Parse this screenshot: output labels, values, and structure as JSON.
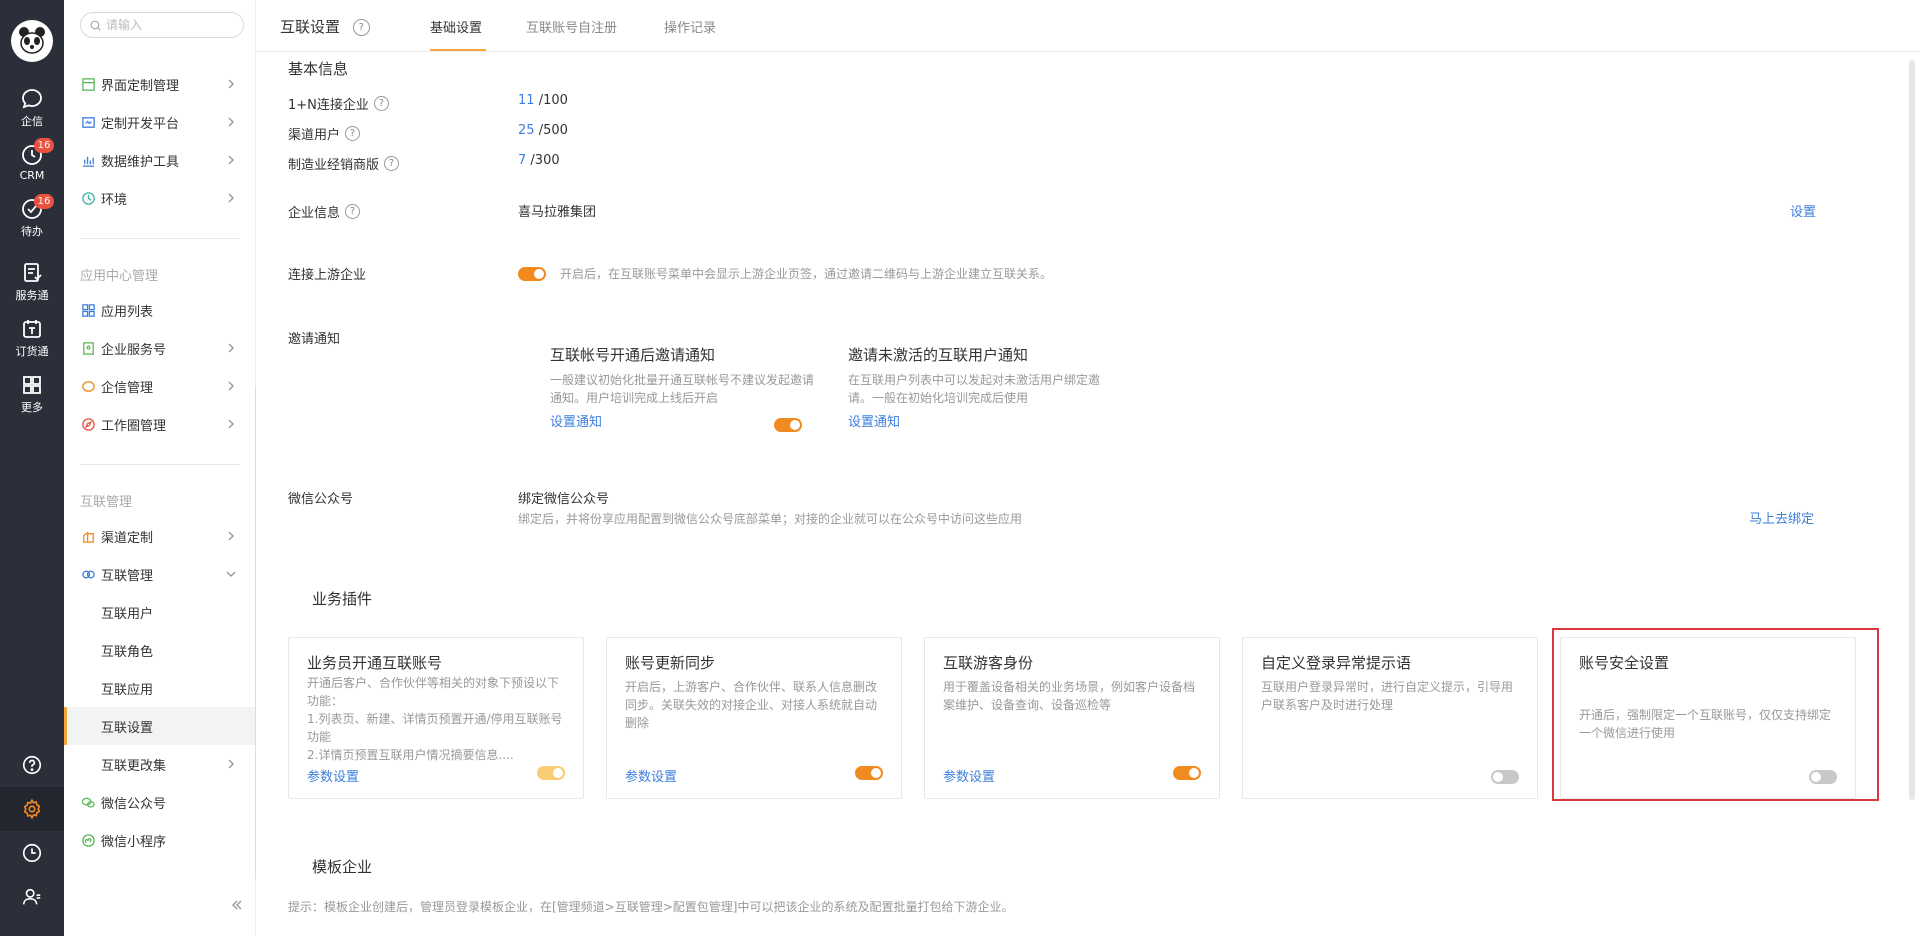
{
  "rail": {
    "items": [
      {
        "label": "企信",
        "icon": "chat-bubble-icon"
      },
      {
        "label": "CRM",
        "icon": "clock-icon",
        "badge": "16"
      },
      {
        "label": "待办",
        "icon": "check-circle-icon",
        "badge": "16"
      },
      {
        "label": "服务通",
        "icon": "service-icon"
      },
      {
        "label": "订货通",
        "icon": "order-icon"
      },
      {
        "label": "更多",
        "icon": "grid-icon"
      }
    ],
    "bottom_icons": [
      "help-circle-icon",
      "gear-icon",
      "history-icon",
      "user-settings-icon"
    ],
    "active_color": "#f28b1f"
  },
  "sidebar": {
    "search_placeholder": "请输入",
    "top_items": [
      {
        "label": "界面定制管理"
      },
      {
        "label": "定制开发平台"
      },
      {
        "label": "数据维护工具"
      },
      {
        "label": "环境"
      }
    ],
    "group_app_center": "应用中心管理",
    "app_items": [
      {
        "label": "应用列表"
      },
      {
        "label": "企业服务号"
      },
      {
        "label": "企信管理"
      },
      {
        "label": "工作圈管理"
      }
    ],
    "group_interconnect": "互联管理",
    "interconnect_items": [
      {
        "label": "渠道定制"
      },
      {
        "label": "互联管理"
      },
      {
        "label": "互联用户"
      },
      {
        "label": "互联角色"
      },
      {
        "label": "互联应用"
      },
      {
        "label": "互联设置"
      },
      {
        "label": "互联更改集"
      },
      {
        "label": "微信公众号"
      },
      {
        "label": "微信小程序"
      }
    ]
  },
  "header": {
    "title": "互联设置",
    "tabs": [
      {
        "label": "基础设置"
      },
      {
        "label": "互联账号自注册"
      },
      {
        "label": "操作记录"
      }
    ]
  },
  "basic": {
    "title": "基本信息",
    "stats": [
      {
        "label": "1+N连接企业",
        "used": "11",
        "total": "/100"
      },
      {
        "label": "渠道用户",
        "used": "25",
        "total": "/500"
      },
      {
        "label": "制造业经销商版",
        "used": "7",
        "total": "/300"
      }
    ],
    "enterprise_label": "企业信息",
    "enterprise_value": "喜马拉雅集团",
    "enterprise_action": "设置",
    "upstream_label": "连接上游企业",
    "upstream_desc": "开启后，在互联账号菜单中会显示上游企业页签，通过邀请二维码与上游企业建立互联关系。",
    "invite_label": "邀请通知",
    "invite_cards": [
      {
        "title": "互联帐号开通后邀请通知",
        "desc": "一般建议初始化批量开通互联帐号不建议发起邀请通知。用户培训完成上线后开启",
        "link": "设置通知"
      },
      {
        "title": "邀请未激活的互联用户通知",
        "desc": "在互联用户列表中可以发起对未激活用户绑定邀请。一般在初始化培训完成后使用",
        "link": "设置通知"
      }
    ],
    "wechat_label": "微信公众号",
    "wechat_title": "绑定微信公众号",
    "wechat_desc": "绑定后，并将份享应用配置到微信公众号底部菜单；对接的企业就可以在公众号中访问这些应用",
    "wechat_action": "马上去绑定"
  },
  "plugins": {
    "title": "业务插件",
    "cards": [
      {
        "title": "业务员开通互联账号",
        "desc": "开通后客户、合作伙伴等相关的对象下预设以下功能：\n1.列表页、新建、详情页预置开通/停用互联账号功能\n2.详情页预置互联用户情况摘要信息....",
        "link": "参数设置",
        "toggle": "light"
      },
      {
        "title": "账号更新同步",
        "desc": "开启后，上游客户、合作伙伴、联系人信息删改同步。关联失效的对接企业、对接人系统就自动删除",
        "link": "参数设置",
        "toggle": "on"
      },
      {
        "title": "互联游客身份",
        "desc": "用于覆盖设备相关的业务场景，例如客户设备档案维护、设备查询、设备巡检等",
        "link": "参数设置",
        "toggle": "on"
      },
      {
        "title": "自定义登录异常提示语",
        "desc": "互联用户登录异常时，进行自定义提示，引导用户联系客户及时进行处理",
        "link": "",
        "toggle": "off"
      },
      {
        "title": "账号安全设置",
        "desc": "开通后，强制限定一个互联账号，仅仅支持绑定一个微信进行使用",
        "link": "",
        "toggle": "off"
      }
    ]
  },
  "template": {
    "title": "模板企业",
    "tip": "提示：模板企业创建后，管理员登录模板企业，在[管理频道>互联管理>配置包管理]中可以把该企业的系统及配置批量打包给下游企业。"
  },
  "colors": {
    "accent": "#f7a63a",
    "link": "#3d7fdc",
    "toggle_on": "#f28b1f",
    "highlight": "#d9363e"
  }
}
